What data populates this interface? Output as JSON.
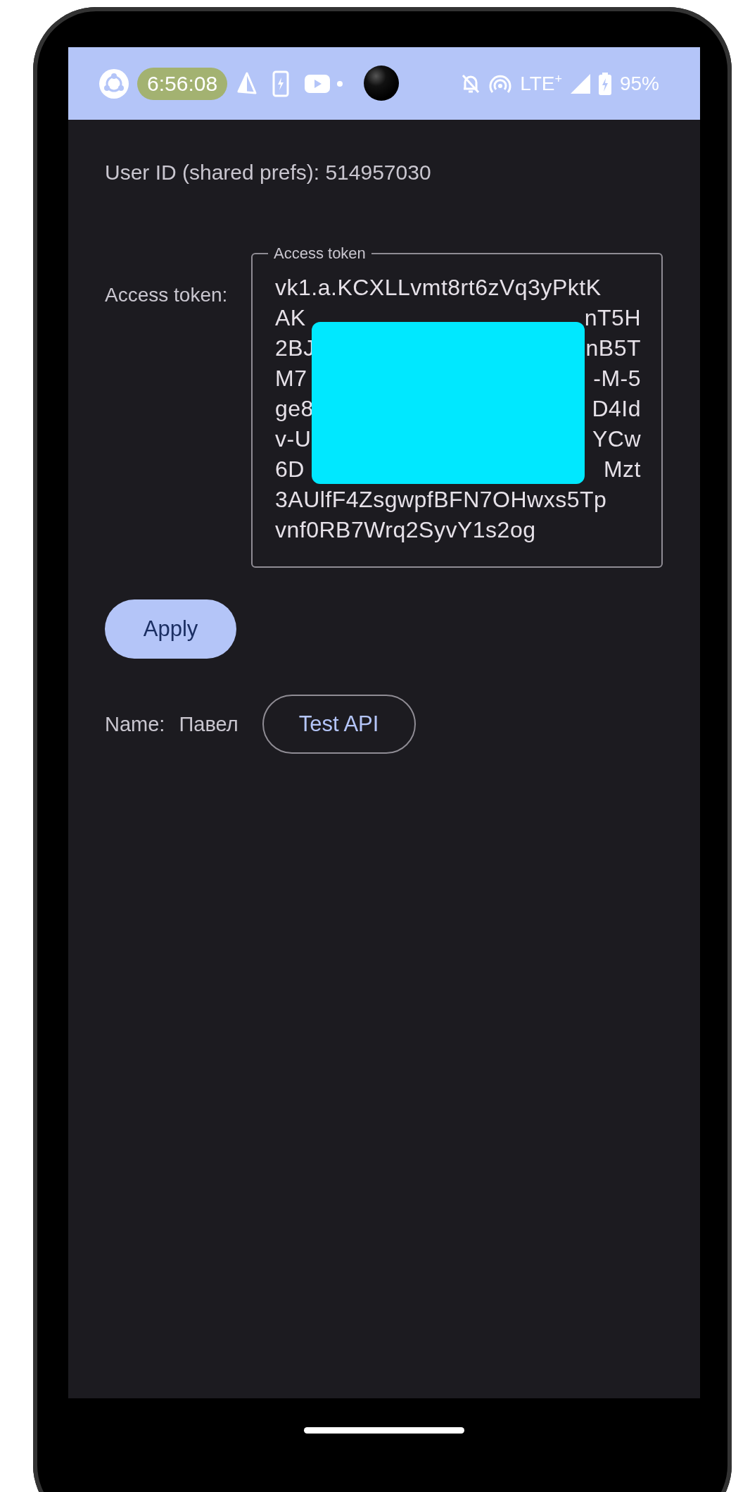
{
  "status_bar": {
    "time": "6:56:08",
    "network": "LTE$^{+}$",
    "battery": "95%"
  },
  "user_id": {
    "label": "User ID (shared prefs): 514957030"
  },
  "token": {
    "label": "Access token:",
    "field_label": "Access token",
    "redacted": true,
    "lines": [
      {
        "left": "vk1.a.KCXLLvmt8rt6zVq3yPktK"
      },
      {
        "left": "AK",
        "right": "nT5H"
      },
      {
        "left": "2BJ",
        "right": "nB5T"
      },
      {
        "left": "M7",
        "right": "-M-5"
      },
      {
        "left": "ge8",
        "right": "D4Id"
      },
      {
        "left": "v-U",
        "right": "YCw"
      },
      {
        "left": "6D",
        "right": "Mzt"
      },
      {
        "left": "3AUlfF4ZsgwpfBFN7OHwxs5Tp"
      },
      {
        "left": "vnf0RB7Wrq2SyvY1s2og"
      }
    ]
  },
  "apply_button": "Apply",
  "name": {
    "label": "Name:",
    "value": "Павел"
  },
  "test_button": "Test API"
}
